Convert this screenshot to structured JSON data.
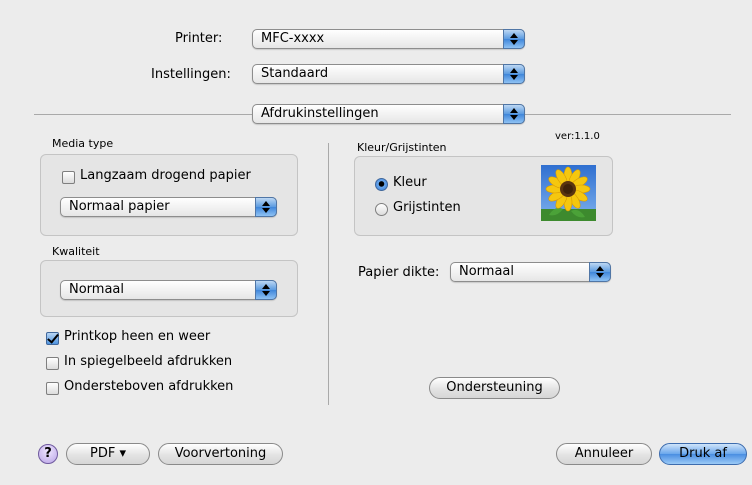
{
  "printer": {
    "label": "Printer:",
    "value": "MFC-xxxx"
  },
  "presets": {
    "label": "Instellingen:",
    "value": "Standaard"
  },
  "panel_menu": {
    "value": "Afdrukinstellingen"
  },
  "version": "ver:1.1.0",
  "left": {
    "media_type": {
      "title": "Media type",
      "slow_dry_label": "Langzaam drogend papier",
      "slow_dry_checked": false,
      "paper_value": "Normaal papier"
    },
    "quality": {
      "title": "Kwaliteit",
      "value": "Normaal"
    },
    "options": [
      {
        "label": "Printkop heen en weer",
        "checked": true
      },
      {
        "label": "In spiegelbeeld afdrukken",
        "checked": false
      },
      {
        "label": "Ondersteboven afdrukken",
        "checked": false
      }
    ]
  },
  "right": {
    "color": {
      "title": "Kleur/Grijstinten",
      "options": [
        {
          "label": "Kleur",
          "selected": true
        },
        {
          "label": "Grijstinten",
          "selected": false
        }
      ]
    },
    "thickness": {
      "label": "Papier dikte:",
      "value": "Normaal"
    },
    "support_label": "Ondersteuning"
  },
  "footer": {
    "help_label": "?",
    "pdf_label": "PDF ▾",
    "preview_label": "Voorvertoning",
    "cancel_label": "Annuleer",
    "print_label": "Druk af"
  },
  "colors": {
    "accent": "#4a8ee2",
    "background": "#ececec"
  }
}
